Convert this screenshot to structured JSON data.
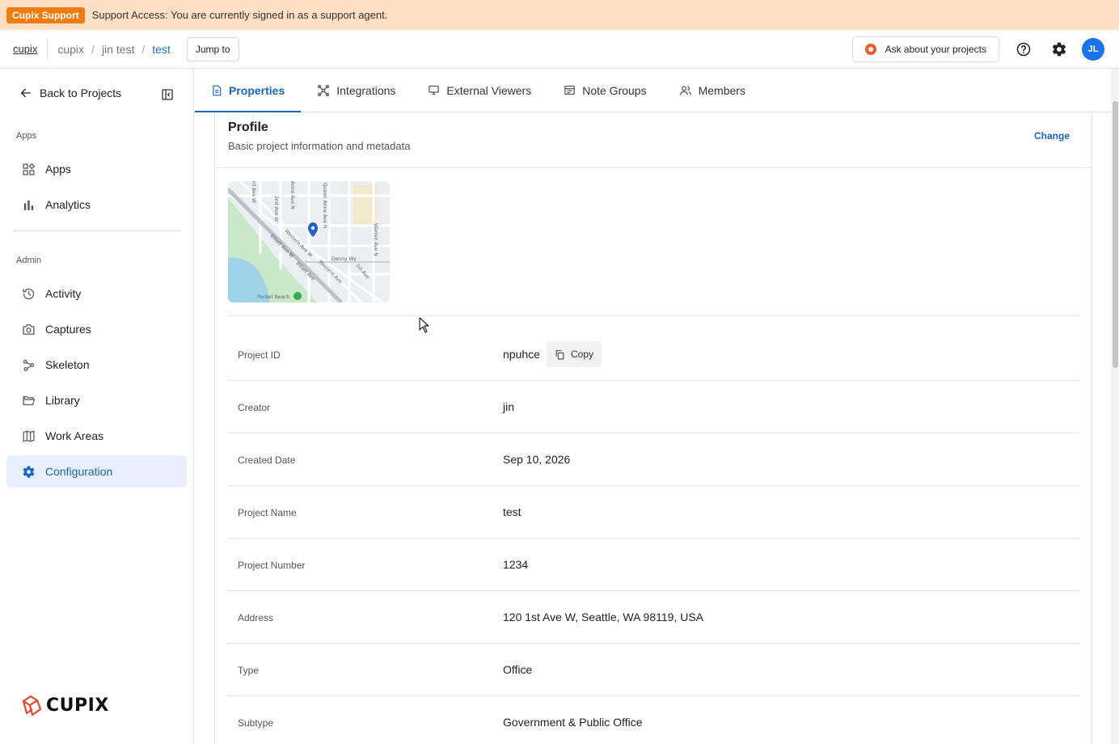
{
  "banner": {
    "badge": "Cupix Support",
    "text": "Support Access: You are currently signed in as a support agent."
  },
  "header": {
    "home": "cupix",
    "breadcrumbs": [
      "cupix",
      "jin test",
      "test"
    ],
    "jump_to": "Jump to",
    "ask_label": "Ask about your projects",
    "avatar_initials": "JL"
  },
  "sidebar": {
    "back_label": "Back to Projects",
    "apps_section": "Apps",
    "apps_items": [
      {
        "label": "Apps",
        "icon": "apps-icon"
      },
      {
        "label": "Analytics",
        "icon": "bar-chart-icon"
      }
    ],
    "admin_section": "Admin",
    "admin_items": [
      {
        "label": "Activity",
        "icon": "history-icon"
      },
      {
        "label": "Captures",
        "icon": "camera-icon"
      },
      {
        "label": "Skeleton",
        "icon": "skeleton-icon"
      },
      {
        "label": "Library",
        "icon": "folder-icon"
      },
      {
        "label": "Work Areas",
        "icon": "map-icon"
      },
      {
        "label": "Configuration",
        "icon": "gear-icon",
        "active": true
      }
    ],
    "logo_text": "CUPIX"
  },
  "tabs": [
    {
      "label": "Properties",
      "icon": "document-icon",
      "active": true
    },
    {
      "label": "Integrations",
      "icon": "network-icon"
    },
    {
      "label": "External Viewers",
      "icon": "monitor-icon"
    },
    {
      "label": "Note Groups",
      "icon": "note-icon"
    },
    {
      "label": "Members",
      "icon": "people-icon"
    }
  ],
  "profile": {
    "title": "Profile",
    "subtitle": "Basic project information and metadata",
    "change_label": "Change",
    "map_labels": [
      "2nd Ave W",
      "Queen Anne Ave N",
      "Warren Ave N",
      "Elliott Ave W",
      "Western Ave W",
      "Denny Wy",
      "1st Ave",
      "Elliott Ave",
      "Western Ave",
      "Pocket Beach",
      "rd Ave W",
      "Anne Ave N"
    ],
    "copy_label": "Copy",
    "fields": [
      {
        "label": "Project ID",
        "value": "npuhce"
      },
      {
        "label": "Creator",
        "value": "jin"
      },
      {
        "label": "Created Date",
        "value": "Sep 10, 2026"
      },
      {
        "label": "Project Name",
        "value": "test"
      },
      {
        "label": "Project Number",
        "value": "1234"
      },
      {
        "label": "Address",
        "value": "120 1st Ave W, Seattle, WA 98119, USA"
      },
      {
        "label": "Type",
        "value": "Office"
      },
      {
        "label": "Subtype",
        "value": "Government & Public Office"
      }
    ]
  },
  "colors": {
    "accent": "#1666c5",
    "banner_bg": "#fde0c3",
    "badge": "#f07b10",
    "active_nav_bg": "#e8f0fd"
  }
}
